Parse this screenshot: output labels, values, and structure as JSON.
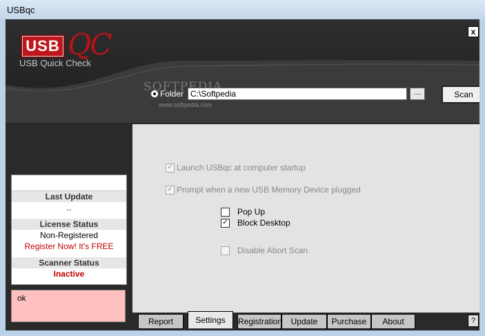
{
  "window": {
    "title": "USBqc"
  },
  "header": {
    "logo_usb": "USB",
    "logo_qc": "QC",
    "subtitle": "USB Quick Check",
    "close_label": "x",
    "watermark": "SOFTPEDIA",
    "watermark_url": "www.softpedia.com"
  },
  "scan": {
    "folder_label": "Folder",
    "folder_value": "C:\\Softpedia",
    "browse_label": "....",
    "scan_label": "Scan"
  },
  "status": {
    "last_update_label": "Last Update",
    "last_update_value": "..",
    "license_status_label": "License Status",
    "license_status_value": "Non-Registered",
    "register_link": "Register Now! It's FREE",
    "scanner_status_label": "Scanner Status",
    "scanner_status_value": "Inactive"
  },
  "log": {
    "text": "ok"
  },
  "settings": {
    "launch_startup": {
      "label": "Launch USBqc at computer startup",
      "checked": true,
      "enabled": false
    },
    "prompt_usb": {
      "label": "Prompt when a new USB Memory Device plugged",
      "checked": true,
      "enabled": false
    },
    "pop_up": {
      "label": "Pop Up",
      "checked": false,
      "enabled": true
    },
    "block_desktop": {
      "label": "Block Desktop",
      "checked": true,
      "enabled": true
    },
    "disable_abort": {
      "label": "Disable Abort Scan",
      "checked": false,
      "enabled": false
    }
  },
  "tabs": {
    "report": "Report",
    "settings": "Settings",
    "registration": "Registration",
    "update": "Update",
    "purchase": "Purchase",
    "about": "About",
    "help": "?"
  }
}
